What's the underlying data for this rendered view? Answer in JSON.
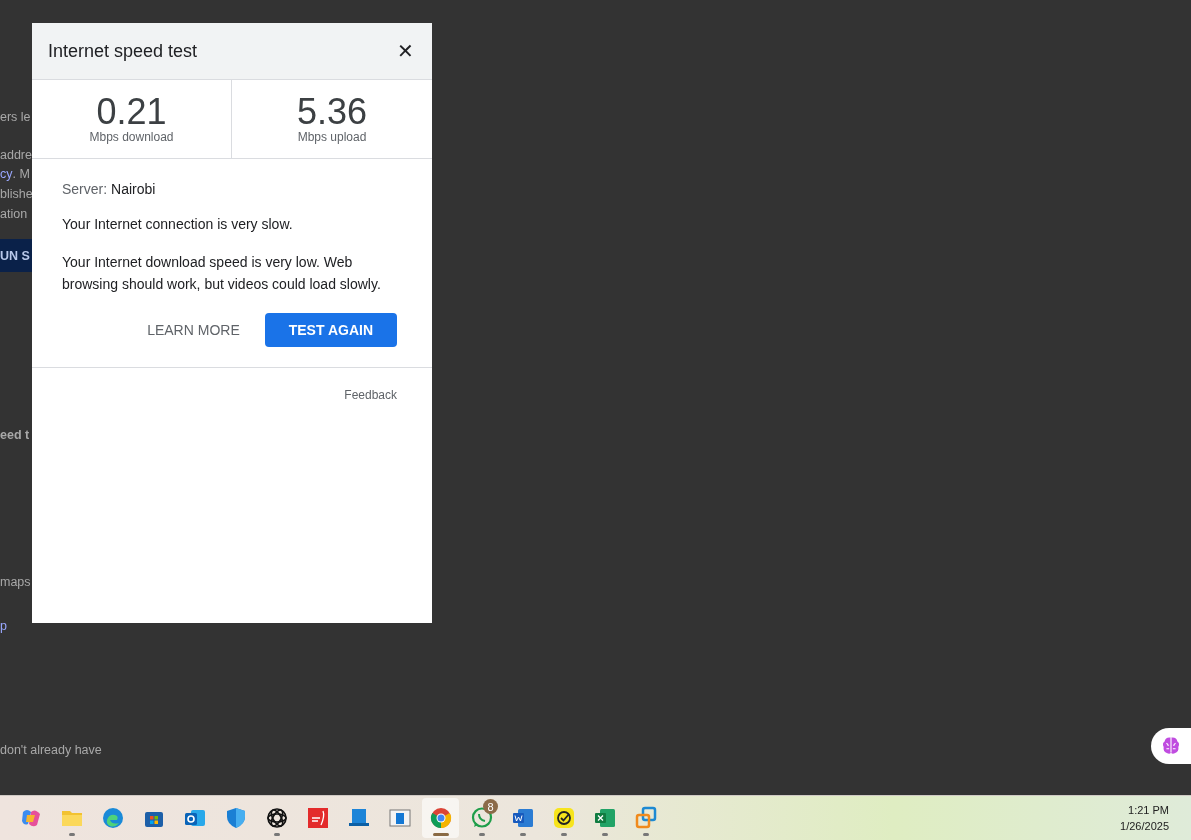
{
  "background_page": {
    "fragments": [
      {
        "kind": "text",
        "text": "ers le"
      },
      {
        "kind": "text",
        "text": "addre"
      },
      {
        "kind": "link",
        "text": "cy",
        "after": ". M"
      },
      {
        "kind": "text",
        "text": "blishe"
      },
      {
        "kind": "text",
        "text": "ation"
      },
      {
        "kind": "button",
        "text": "UN S"
      },
      {
        "kind": "heading",
        "text": "eed t"
      },
      {
        "kind": "text",
        "text": "maps"
      },
      {
        "kind": "link",
        "text": "p"
      },
      {
        "kind": "text",
        "text": "don't already have"
      }
    ]
  },
  "dialog": {
    "title": "Internet speed test",
    "close": "✕",
    "results": [
      {
        "value": "0.21",
        "unit": "Mbps download"
      },
      {
        "value": "5.36",
        "unit": "Mbps upload"
      }
    ],
    "server_label": "Server:",
    "server": "Nairobi",
    "messages": [
      "Your Internet connection is very slow.",
      "Your Internet download speed is very low. Web browsing should work, but videos could load slowly."
    ],
    "buttons": [
      {
        "label": "LEARN MORE",
        "kind": "text"
      },
      {
        "label": "TEST AGAIN",
        "kind": "primary"
      }
    ],
    "feedback": "Feedback"
  },
  "taskbar": {
    "apps": [
      {
        "kind": "copilot",
        "running": false,
        "selected": false
      },
      {
        "kind": "folder",
        "running": true,
        "selected": false
      },
      {
        "kind": "edge",
        "running": false,
        "selected": false
      },
      {
        "kind": "store",
        "running": false,
        "selected": false
      },
      {
        "kind": "outlook",
        "running": false,
        "selected": false
      },
      {
        "kind": "shield",
        "running": false,
        "selected": false
      },
      {
        "kind": "knot",
        "running": true,
        "selected": false
      },
      {
        "kind": "pdf",
        "running": false,
        "selected": false
      },
      {
        "kind": "laptop",
        "running": false,
        "selected": false
      },
      {
        "kind": "window",
        "running": false,
        "selected": false
      },
      {
        "kind": "chrome",
        "running": true,
        "selected": true
      },
      {
        "kind": "whatsapp",
        "running": true,
        "selected": false,
        "badge": "8"
      },
      {
        "kind": "word",
        "running": true,
        "selected": false
      },
      {
        "kind": "check",
        "running": true,
        "selected": false
      },
      {
        "kind": "excel",
        "running": true,
        "selected": false
      },
      {
        "kind": "vm",
        "running": true,
        "selected": false
      }
    ],
    "time": "1:21 PM",
    "date": "1/26/2025"
  }
}
